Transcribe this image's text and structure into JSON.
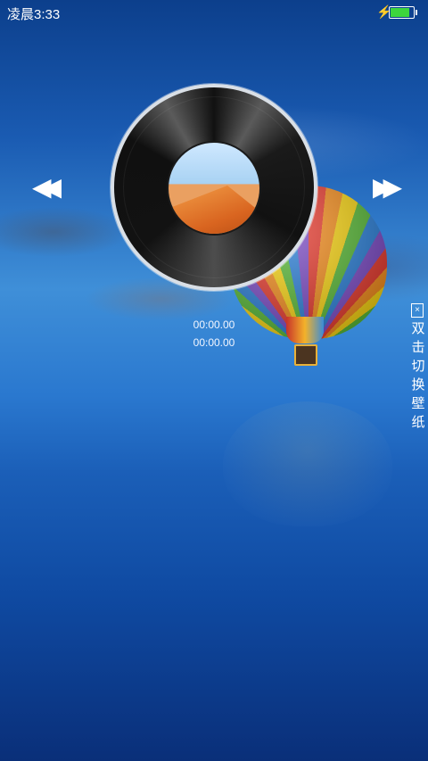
{
  "status_bar": {
    "time": "凌晨3:33",
    "battery_level": 0.85,
    "charging": true
  },
  "player": {
    "current_time": "00:00.00",
    "total_time": "00:00.00"
  },
  "controls": {
    "rewind_glyph": "◀◀",
    "forward_glyph": "▶▶"
  },
  "wallpaper_hint": {
    "close_glyph": "×",
    "lines": [
      "双",
      "击",
      "切",
      "换",
      "壁",
      "纸"
    ]
  },
  "icons": [
    "charging-icon",
    "battery-icon",
    "rewind-icon",
    "fast-forward-icon",
    "close-icon"
  ]
}
